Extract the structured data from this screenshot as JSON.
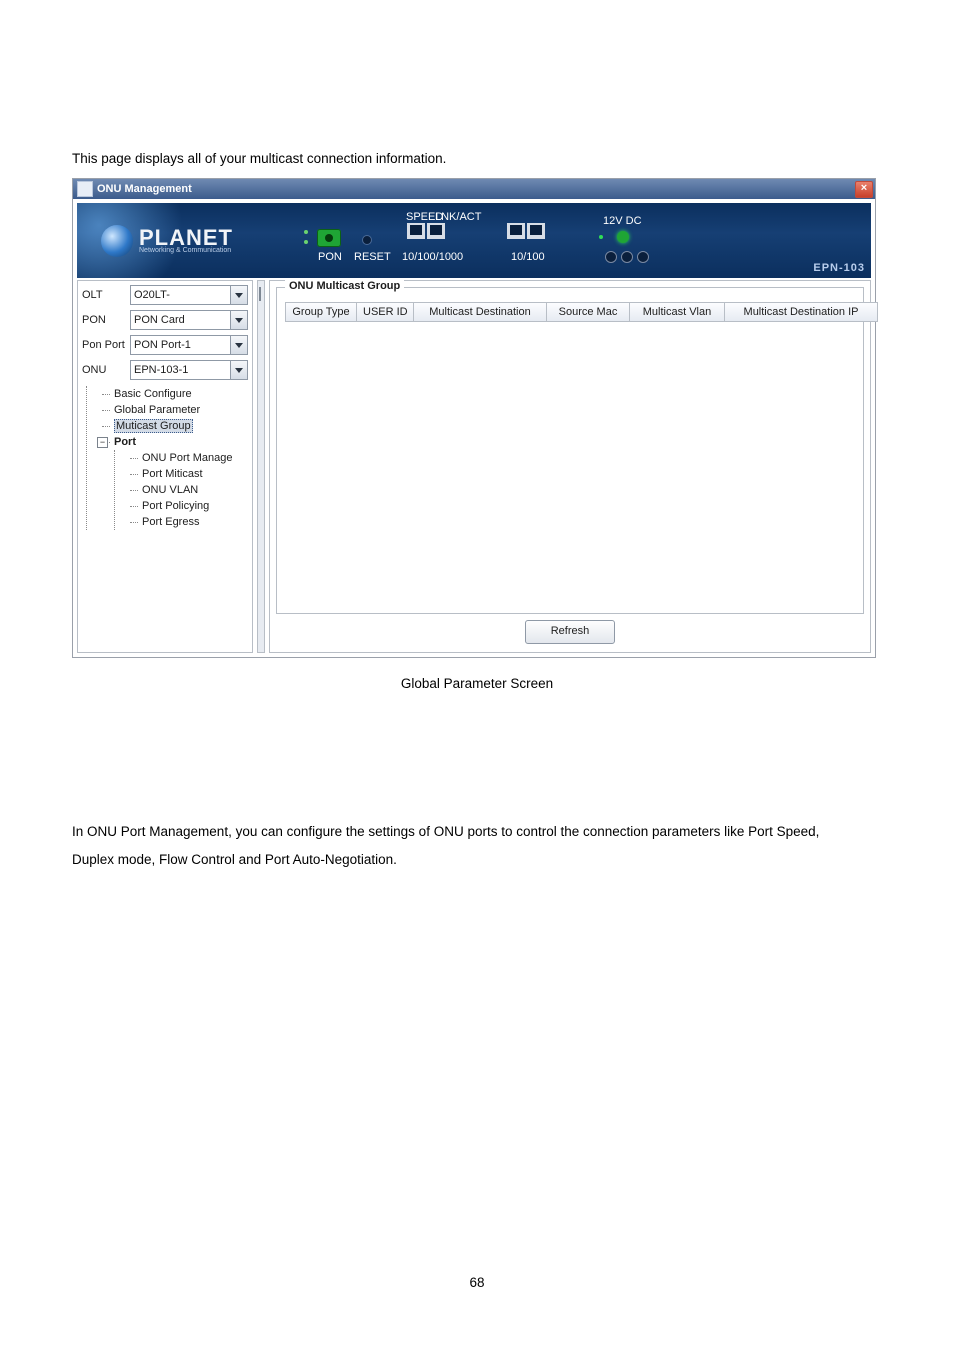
{
  "doc": {
    "intro_line": "This page displays all of your multicast connection information.",
    "caption": "Global Parameter Screen",
    "section_text_1": "In ONU Port Management, you can configure the settings of ONU ports to control the connection parameters like Port Speed,",
    "section_text_2": "Duplex mode, Flow Control and Port Auto-Negotiation.",
    "page_number": "68"
  },
  "window": {
    "title": "ONU Management",
    "close_glyph": "×"
  },
  "banner": {
    "brand": "PLANET",
    "tagline": "Networking & Communication",
    "labels": {
      "pon": "PON",
      "reset": "RESET",
      "speed": "SPEED",
      "lnkact": "LNK/ACT",
      "ten_hundred_thousand": "10/100/1000",
      "ten_hundred": "10/100",
      "v12dc": "12V DC"
    },
    "model": "EPN-103"
  },
  "sidebar": {
    "rows": {
      "olt_label": "OLT",
      "olt_value": "O20LT-",
      "pon_label": "PON",
      "pon_value": "PON Card",
      "ponport_label": "Pon Port",
      "ponport_value": "PON Port-1",
      "onu_label": "ONU",
      "onu_value": "EPN-103-1"
    },
    "tree": {
      "n0": "Basic Configure",
      "n1": "Global Parameter",
      "n2": "Muticast Group",
      "port_label": "Port",
      "port_toggle": "−",
      "p0": "ONU Port Manage",
      "p1": "Port Miticast",
      "p2": "ONU VLAN",
      "p3": "Port Policying",
      "p4": "Port Egress"
    }
  },
  "content": {
    "group_legend": "ONU Multicast Group",
    "headers": {
      "h0": "Group Type",
      "h1": "USER ID",
      "h2": "Multicast Destination",
      "h3": "Source Mac",
      "h4": "Multicast Vlan",
      "h5": "Multicast Destination IP"
    },
    "refresh": "Refresh"
  }
}
